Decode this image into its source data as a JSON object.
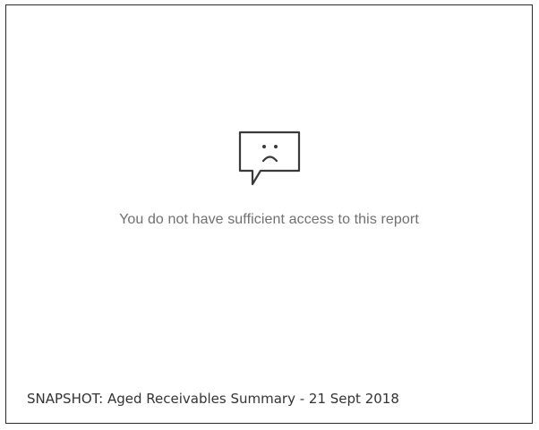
{
  "report": {
    "icon": "sad-speech-bubble-icon",
    "message": "You do not have sufficient access to this report",
    "caption": "SNAPSHOT: Aged Receivables Summary - 21 Sept 2018"
  },
  "colors": {
    "border": "#2b2b2b",
    "icon_stroke": "#3a3a3a",
    "message_text": "#707070",
    "caption_text": "#333333"
  }
}
